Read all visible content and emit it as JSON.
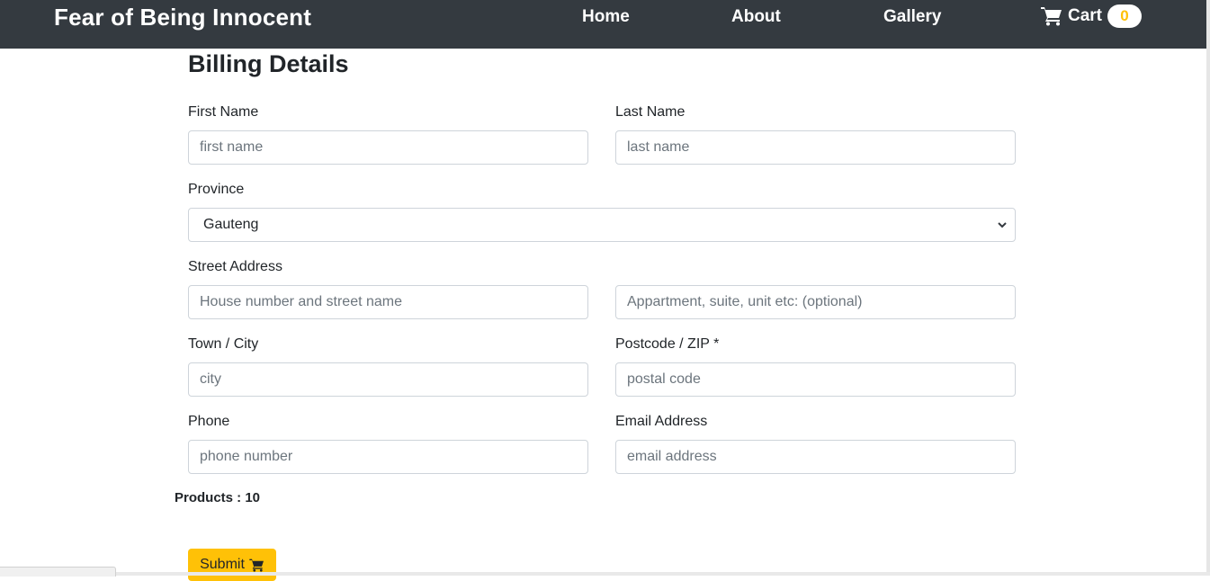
{
  "nav": {
    "brand": "Fear of Being Innocent",
    "links": [
      "Home",
      "About",
      "Gallery"
    ],
    "cart_label": "Cart",
    "cart_count": "0"
  },
  "form": {
    "title": "Billing Details",
    "first_name": {
      "label": "First Name",
      "placeholder": "first name",
      "value": ""
    },
    "last_name": {
      "label": "Last Name",
      "placeholder": "last name",
      "value": ""
    },
    "province": {
      "label": "Province",
      "selected": "Gauteng"
    },
    "street": {
      "label": "Street Address",
      "placeholder_1": "House number and street name",
      "placeholder_2": "Appartment, suite, unit etc: (optional)"
    },
    "city": {
      "label": "Town / City",
      "placeholder": "city",
      "value": ""
    },
    "postcode": {
      "label": "Postcode / ZIP *",
      "placeholder": "postal code",
      "value": ""
    },
    "phone": {
      "label": "Phone",
      "placeholder": "phone number",
      "value": ""
    },
    "email": {
      "label": "Email Address",
      "placeholder": "email address",
      "value": ""
    },
    "products": "Products : 10",
    "submit_label": "Submit"
  },
  "colors": {
    "navbar": "#343a40",
    "accent": "#ffc107",
    "border": "#ced4da"
  },
  "icons": {
    "cart": "shopping-cart-icon",
    "submit": "shopping-cart-icon",
    "select": "chevron-down-icon"
  }
}
